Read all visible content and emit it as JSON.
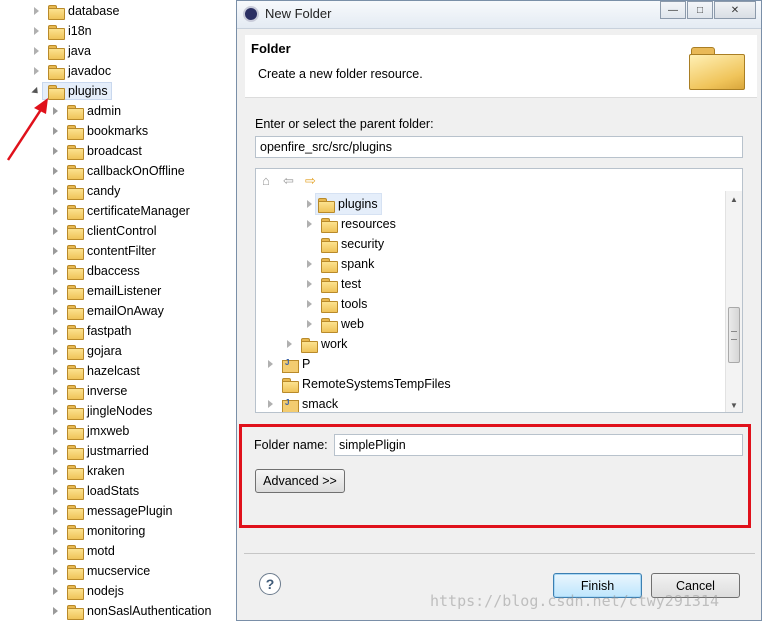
{
  "explorer": {
    "items": [
      {
        "label": "database",
        "state": "collapsed"
      },
      {
        "label": "i18n",
        "state": "collapsed"
      },
      {
        "label": "java",
        "state": "collapsed"
      },
      {
        "label": "javadoc",
        "state": "collapsed"
      },
      {
        "label": "plugins",
        "state": "expanded",
        "selected": true
      },
      {
        "label": "admin",
        "state": "collapsed"
      },
      {
        "label": "bookmarks",
        "state": "collapsed"
      },
      {
        "label": "broadcast",
        "state": "collapsed"
      },
      {
        "label": "callbackOnOffline",
        "state": "collapsed"
      },
      {
        "label": "candy",
        "state": "collapsed"
      },
      {
        "label": "certificateManager",
        "state": "collapsed"
      },
      {
        "label": "clientControl",
        "state": "collapsed"
      },
      {
        "label": "contentFilter",
        "state": "collapsed"
      },
      {
        "label": "dbaccess",
        "state": "collapsed"
      },
      {
        "label": "emailListener",
        "state": "collapsed"
      },
      {
        "label": "emailOnAway",
        "state": "collapsed"
      },
      {
        "label": "fastpath",
        "state": "collapsed"
      },
      {
        "label": "gojara",
        "state": "collapsed"
      },
      {
        "label": "hazelcast",
        "state": "collapsed"
      },
      {
        "label": "inverse",
        "state": "collapsed"
      },
      {
        "label": "jingleNodes",
        "state": "collapsed"
      },
      {
        "label": "jmxweb",
        "state": "collapsed"
      },
      {
        "label": "justmarried",
        "state": "collapsed"
      },
      {
        "label": "kraken",
        "state": "collapsed"
      },
      {
        "label": "loadStats",
        "state": "collapsed"
      },
      {
        "label": "messagePlugin",
        "state": "collapsed"
      },
      {
        "label": "monitoring",
        "state": "collapsed"
      },
      {
        "label": "motd",
        "state": "collapsed"
      },
      {
        "label": "mucservice",
        "state": "collapsed"
      },
      {
        "label": "nodejs",
        "state": "collapsed"
      },
      {
        "label": "nonSaslAuthentication",
        "state": "collapsed"
      }
    ]
  },
  "dialog": {
    "title": "New Folder",
    "window_buttons": [
      "minimize",
      "maximize",
      "close"
    ],
    "banner_title": "Folder",
    "banner_message": "Create a new folder resource.",
    "parent_label": "Enter or select the parent folder:",
    "parent_value": "openfire_src/src/plugins",
    "nav_icons": [
      "home-icon",
      "back-icon",
      "forward-icon"
    ],
    "picker_items": [
      {
        "label": "plugins",
        "state": "collapsed"
      },
      {
        "label": "resources",
        "state": "collapsed"
      },
      {
        "label": "security",
        "state": "none"
      },
      {
        "label": "spank",
        "state": "collapsed"
      },
      {
        "label": "test",
        "state": "collapsed"
      },
      {
        "label": "tools",
        "state": "collapsed"
      },
      {
        "label": "web",
        "state": "collapsed"
      },
      {
        "label": "work",
        "state": "collapsed"
      },
      {
        "label": "P",
        "state": "collapsed"
      },
      {
        "label": "RemoteSystemsTempFiles",
        "state": "none"
      },
      {
        "label": "smack",
        "state": "collapsed"
      }
    ],
    "folder_name_label": "Folder name:",
    "folder_name_value": "simplePligin",
    "advanced_label": "Advanced >>",
    "help_label": "?",
    "finish_label": "Finish",
    "cancel_label": "Cancel"
  },
  "watermark": "https://blog.csdn.net/ctwy291314",
  "colors": {
    "highlight_box": "#e0111b",
    "annotation_arrow": "#e0111b",
    "folder": "#f0c45a"
  }
}
